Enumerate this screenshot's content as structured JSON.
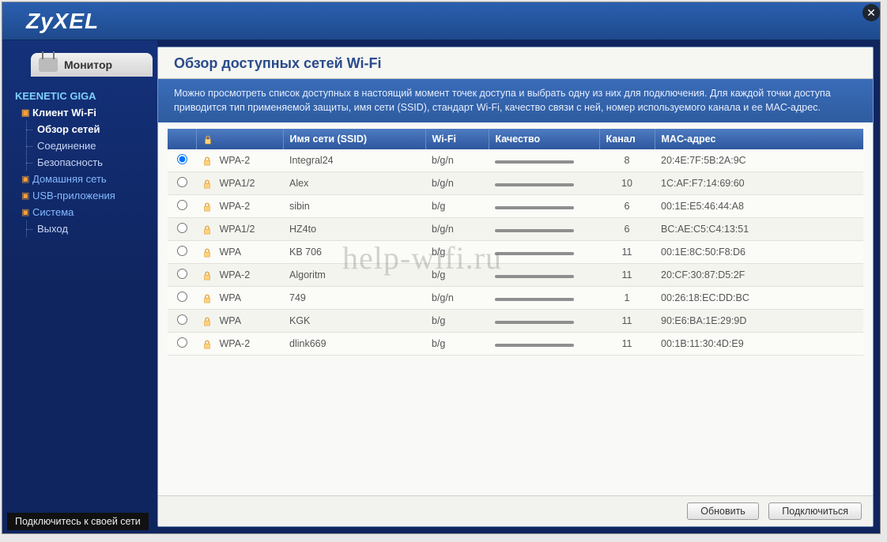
{
  "brand": "ZyXEL",
  "monitor_tab_label": "Монитор",
  "sidebar": {
    "root_label": "KEENETIC GIGA",
    "groups": [
      {
        "label": "Клиент Wi-Fi",
        "active": true,
        "items": [
          {
            "label": "Обзор сетей",
            "active": true
          },
          {
            "label": "Соединение"
          },
          {
            "label": "Безопасность"
          }
        ]
      },
      {
        "label": "Домашняя сеть"
      },
      {
        "label": "USB-приложения"
      },
      {
        "label": "Система"
      }
    ],
    "exit_label": "Выход"
  },
  "content": {
    "title": "Обзор доступных сетей Wi-Fi",
    "description": "Можно просмотреть список доступных в настоящий момент точек доступа и выбрать одну из них для подключения. Для каждой точки доступа приводится тип применяемой защиты, имя сети (SSID), стандарт Wi-Fi, качество связи с ней, номер используемого канала и ее MAC-адрес."
  },
  "table": {
    "headers": {
      "security": "",
      "ssid": "Имя сети (SSID)",
      "wifi": "Wi-Fi",
      "quality": "Качество",
      "channel": "Канал",
      "mac": "MAC-адрес"
    },
    "rows": [
      {
        "selected": true,
        "security": "WPA-2",
        "ssid": "Integral24",
        "wifi": "b/g/n",
        "channel": "8",
        "mac": "20:4E:7F:5B:2A:9C"
      },
      {
        "selected": false,
        "security": "WPA1/2",
        "ssid": "Alex",
        "wifi": "b/g/n",
        "channel": "10",
        "mac": "1C:AF:F7:14:69:60"
      },
      {
        "selected": false,
        "security": "WPA-2",
        "ssid": "sibin",
        "wifi": "b/g",
        "channel": "6",
        "mac": "00:1E:E5:46:44:A8"
      },
      {
        "selected": false,
        "security": "WPA1/2",
        "ssid": "HZ4to",
        "wifi": "b/g/n",
        "channel": "6",
        "mac": "BC:AE:C5:C4:13:51"
      },
      {
        "selected": false,
        "security": "WPA",
        "ssid": "KB 706",
        "wifi": "b/g",
        "channel": "11",
        "mac": "00:1E:8C:50:F8:D6"
      },
      {
        "selected": false,
        "security": "WPA-2",
        "ssid": "Algoritm",
        "wifi": "b/g",
        "channel": "11",
        "mac": "20:CF:30:87:D5:2F"
      },
      {
        "selected": false,
        "security": "WPA",
        "ssid": "749",
        "wifi": "b/g/n",
        "channel": "1",
        "mac": "00:26:18:EC:DD:BC"
      },
      {
        "selected": false,
        "security": "WPA",
        "ssid": "KGK",
        "wifi": "b/g",
        "channel": "11",
        "mac": "90:E6:BA:1E:29:9D"
      },
      {
        "selected": false,
        "security": "WPA-2",
        "ssid": "dlink669",
        "wifi": "b/g",
        "channel": "11",
        "mac": "00:1B:11:30:4D:E9"
      }
    ]
  },
  "buttons": {
    "refresh": "Обновить",
    "connect": "Подключиться"
  },
  "tooltip": "Подключитесь к своей сети",
  "watermark": "help-wifi.ru"
}
